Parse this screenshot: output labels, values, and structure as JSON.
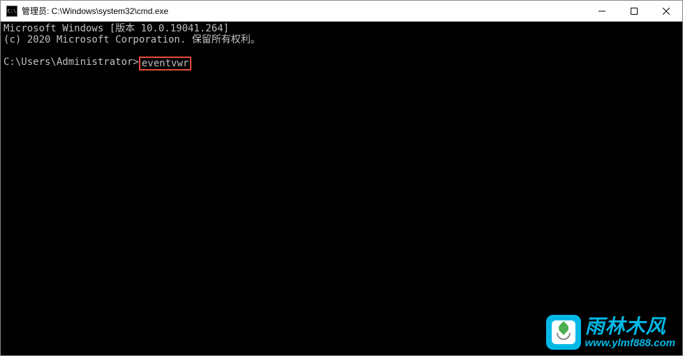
{
  "titlebar": {
    "icon_text": "C:\\",
    "title": "管理员: C:\\Windows\\system32\\cmd.exe"
  },
  "terminal": {
    "line1": "Microsoft Windows [版本 10.0.19041.264]",
    "line2": "(c) 2020 Microsoft Corporation. 保留所有权利。",
    "prompt": "C:\\Users\\Administrator>",
    "command": "eventvwr"
  },
  "watermark": {
    "brand_cn": "雨林木风",
    "url": "www.ylmf888.com"
  }
}
